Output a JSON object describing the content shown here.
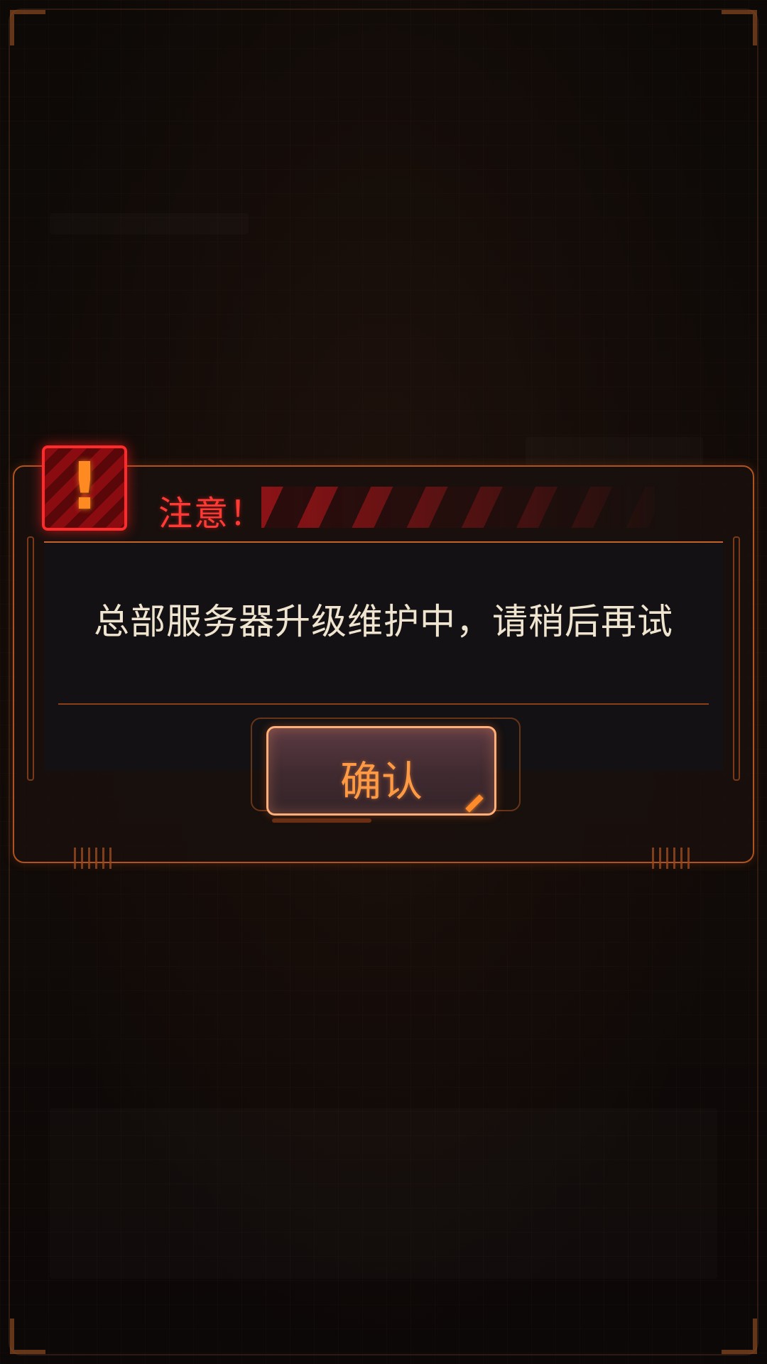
{
  "dialog": {
    "title": "注意！",
    "message": "总部服务器升级维护中，请稍后再试",
    "confirm_label": "确认"
  },
  "icons": {
    "warning": "warning-exclamation-icon"
  },
  "colors": {
    "accent_orange": "#ff9a44",
    "alert_red": "#ff3a35",
    "frame_orange": "#b0521f",
    "text_cream": "#efe4cf",
    "background": "#0b0807"
  }
}
